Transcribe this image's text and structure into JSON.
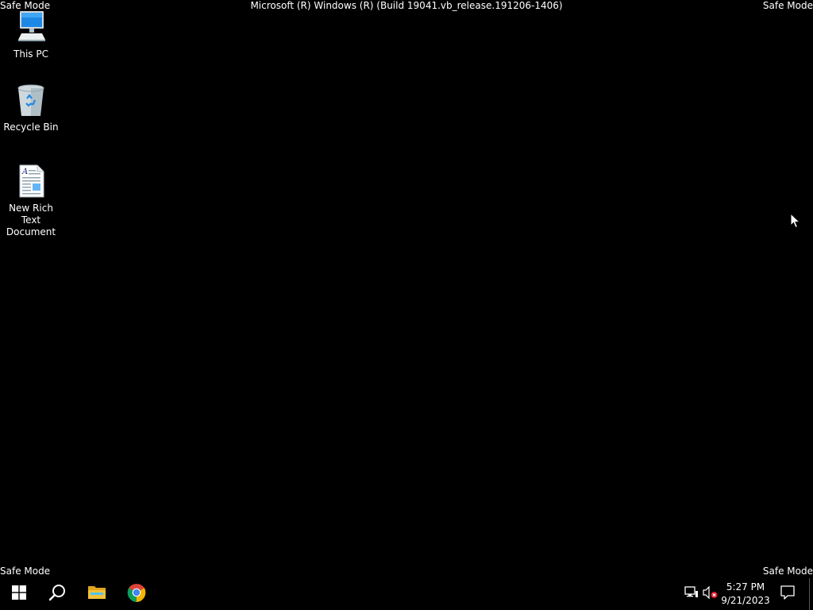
{
  "overlay": {
    "safe_mode_top_left": "Safe Mode",
    "safe_mode_top_right": "Safe Mode",
    "safe_mode_bottom_left": "Safe Mode",
    "safe_mode_bottom_right": "Safe Mode",
    "build_title": "Microsoft (R) Windows (R) (Build 19041.vb_release.191206-1406)"
  },
  "desktop": {
    "icons": [
      {
        "label": "This PC",
        "icon": "computer-icon"
      },
      {
        "label": "Recycle Bin",
        "icon": "recycle-bin-icon"
      },
      {
        "label": "New Rich Text Document",
        "icon": "rich-text-document-icon"
      }
    ]
  },
  "taskbar": {
    "pinned": [
      {
        "icon": "windows-start-icon"
      },
      {
        "icon": "search-icon"
      },
      {
        "icon": "file-explorer-icon"
      },
      {
        "icon": "chrome-icon"
      }
    ],
    "tray": {
      "network_icon": "network-disconnected-icon",
      "volume_icon": "volume-muted-icon",
      "time": "5:27 PM",
      "date": "9/21/2023",
      "notification_icon": "action-center-icon"
    }
  },
  "colors": {
    "background": "#000000",
    "text": "#ffffff",
    "windows_logo": "#ffffff",
    "folder_yellow": "#f3c13a",
    "chrome_red": "#db4437",
    "chrome_green": "#0f9d58",
    "chrome_yellow": "#f4b400",
    "chrome_blue": "#4285f4",
    "error_red": "#e81123"
  }
}
